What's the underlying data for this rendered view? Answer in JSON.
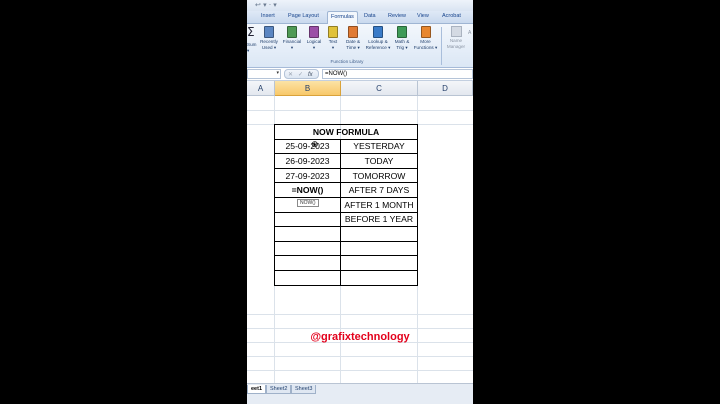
{
  "titlebar": {
    "glyphs": "↩ ▾ ·  ▾"
  },
  "ribbon_tabs": [
    "Insert",
    "Page Layout",
    "Formulas",
    "Data",
    "Review",
    "View",
    "Acrobat"
  ],
  "active_tab": "Formulas",
  "ribbon": {
    "autosum_label": "Sum\n▾",
    "sigma": "Σ",
    "buttons": [
      {
        "label": "Recently\nUsed ▾",
        "icon": "recently-used-book-icon",
        "color": "#5b86c2"
      },
      {
        "label": "Financial\n▾",
        "icon": "financial-book-icon",
        "color": "#4f9a55"
      },
      {
        "label": "Logical\n▾",
        "icon": "logical-book-icon",
        "color": "#9b4fa7"
      },
      {
        "label": "Text\n▾",
        "icon": "text-book-icon",
        "color": "#e0c23a"
      },
      {
        "label": "Date &\nTime ▾",
        "icon": "date-time-book-icon",
        "color": "#e07a34"
      },
      {
        "label": "Lookup &\nReference ▾",
        "icon": "lookup-reference-book-icon",
        "color": "#3a7bc8"
      },
      {
        "label": "Math &\nTrig ▾",
        "icon": "math-trig-book-icon",
        "color": "#3f9b58"
      },
      {
        "label": "More\nFunctions ▾",
        "icon": "more-functions-book-icon",
        "color": "#e8862e"
      }
    ],
    "group_label": "Function Library",
    "name_manager": "Name\nManager",
    "right_stub": "A"
  },
  "formula_bar": {
    "name_box": "",
    "buttons": [
      "✕",
      "✓",
      "fx"
    ],
    "formula": "=NOW()"
  },
  "columns": [
    "A",
    "B",
    "C",
    "D"
  ],
  "selected_column": "B",
  "table": {
    "title": "NOW FORMULA",
    "rows": [
      {
        "b": "25-09-2023",
        "c": "YESTERDAY"
      },
      {
        "b": "26-09-2023",
        "c": "TODAY"
      },
      {
        "b": "27-09-2023",
        "c": "TOMORROW"
      },
      {
        "b": "=NOW()",
        "c": "AFTER 7 DAYS"
      },
      {
        "b": "",
        "c": "AFTER 1 MONTH"
      },
      {
        "b": "",
        "c": "BEFORE 1 YEAR"
      },
      {
        "b": "",
        "c": ""
      },
      {
        "b": "",
        "c": ""
      },
      {
        "b": "",
        "c": ""
      },
      {
        "b": "",
        "c": ""
      }
    ]
  },
  "tooltip": "NOW()",
  "watermark": "@grafixtechnology",
  "sheets": [
    "eet1",
    "Sheet2",
    "Sheet3"
  ],
  "active_sheet": "eet1"
}
